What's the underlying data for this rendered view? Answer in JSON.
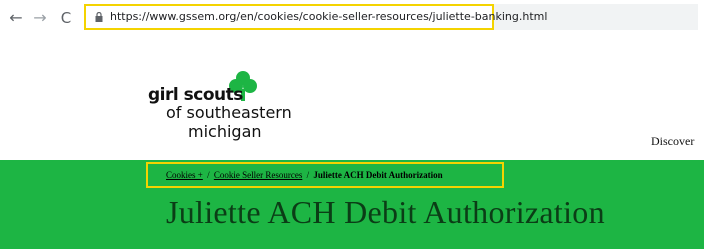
{
  "browser": {
    "url": "https://www.gssem.org/en/cookies/cookie-seller-resources/juliette-banking.html"
  },
  "logo": {
    "line1": "girl scouts",
    "line2": "of southeastern",
    "line3": "michigan"
  },
  "nav": {
    "discover_label": "Discover"
  },
  "breadcrumb": {
    "items": [
      "Cookies +",
      "Cookie Seller Resources",
      "Juliette ACH Debit Authorization"
    ],
    "separator": "/"
  },
  "page": {
    "title": "Juliette ACH Debit Authorization"
  },
  "colors": {
    "hero_green": "#1db544",
    "highlight_yellow": "#f4d300",
    "trefoil_green": "#1db544"
  }
}
